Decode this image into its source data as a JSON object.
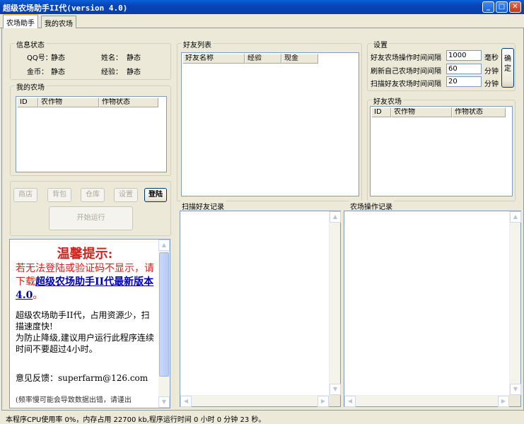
{
  "window": {
    "title": "超级农场助手II代(version 4.0)"
  },
  "tabs": [
    {
      "label": "农场助手"
    },
    {
      "label": "我的农场"
    }
  ],
  "info": {
    "group_label": "信息状态",
    "qq_label": "QQ号：",
    "qq_value": "静态",
    "name_label": "姓名：",
    "name_value": "静态",
    "gold_label": "金币：",
    "gold_value": "静态",
    "exp_label": "经验：",
    "exp_value": "静态"
  },
  "my_farm": {
    "group_label": "我的农场",
    "columns": [
      "ID",
      "农作物",
      "作物状态"
    ]
  },
  "buttons": {
    "shop": "商店",
    "bag": "背包",
    "warehouse": "仓库",
    "settings": "设置",
    "login": "登陆",
    "start": "开始运行"
  },
  "friends": {
    "group_label": "好友列表",
    "columns": [
      "好友名称",
      "经验",
      "现金"
    ]
  },
  "settings": {
    "group_label": "设置",
    "rows": [
      {
        "label": "好友农场操作时间间隔",
        "value": "1000",
        "unit": "毫秒"
      },
      {
        "label": "刷新自己农场时间间隔",
        "value": "60",
        "unit": "分钟"
      },
      {
        "label": "扫描好友农场时间间隔",
        "value": "20",
        "unit": "分钟"
      }
    ],
    "confirm": "确定"
  },
  "friend_farm": {
    "group_label": "好友农场",
    "columns": [
      "ID",
      "农作物",
      "作物状态"
    ]
  },
  "logs": {
    "scan_label": "扫描好友记录",
    "ops_label": "农场操作记录"
  },
  "notice": {
    "title": "温馨提示:",
    "red_text": "若无法登陆或验证码不显示，请下载",
    "link_text": "超级农场助手II代最新版本4.0",
    "red_tail": "。",
    "body1": "超级农场助手II代，占用资源少，扫描速度快!",
    "body2": "为防止降级,建议用户运行此程序连续时间不要超过4小时。",
    "feedback": "意见反馈：superfarm@126.com",
    "more": "(频率慢可能会导致数据出错，请谨出"
  },
  "status": {
    "text": "本程序CPU使用率 0%，内存占用 22700 kb,程序运行时间 0 小时 0 分钟 23 秒。"
  }
}
